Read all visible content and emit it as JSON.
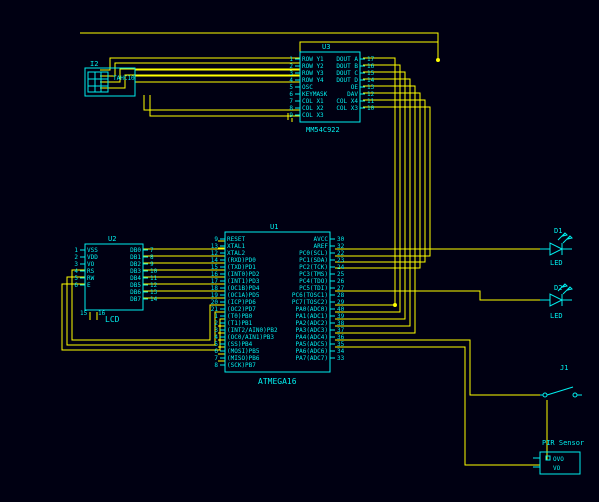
{
  "components": {
    "U1": {
      "ref": "U1",
      "part": "ATMEGA16",
      "left_pins": [
        "RESET",
        "XTAL1",
        "XTAL2",
        "(RXD)PD0",
        "(TXD)PD1",
        "(INT0)PD2",
        "(INT1)PD3",
        "(OC1B)PD4",
        "(OC1A)PD5",
        "(ICP)PD6",
        "(OC2)PD7",
        "(T0)PB0",
        "(T1)PB1",
        "(INT2/AIN0)PB2",
        "(OC0/AIN1)PB3",
        "(SS)PB4",
        "(MOSI)PB5",
        "(MISO)PB6",
        "(SCK)PB7"
      ],
      "right_pins": [
        "AVCC",
        "AREF",
        "PC0(SCL)",
        "PC1(SDA)",
        "PC2(TCK)",
        "PC3(TMS)",
        "PC4(TDO)",
        "PC5(TDI)",
        "PC6(TOSC1)",
        "PC7(TOSC2)",
        "PA0(ADC0)",
        "PA1(ADC1)",
        "PA2(ADC2)",
        "PA3(ADC3)",
        "PA4(ADC4)",
        "PA5(ADC5)",
        "PA6(ADC6)",
        "PA7(ADC7)"
      ],
      "left_nums": [
        "9",
        "13",
        "12",
        "14",
        "15",
        "16",
        "17",
        "18",
        "19",
        "20",
        "21",
        "1",
        "2",
        "3",
        "4",
        "5",
        "6",
        "7",
        "8"
      ],
      "right_nums": [
        "30",
        "32",
        "22",
        "23",
        "24",
        "25",
        "26",
        "27",
        "28",
        "29",
        "40",
        "39",
        "38",
        "37",
        "36",
        "35",
        "34",
        "33"
      ]
    },
    "U2": {
      "ref": "U2",
      "part": "LCD",
      "left_pins": [
        "VSS",
        "VDD",
        "VO",
        "RS",
        "RW",
        "E"
      ],
      "right_pins": [
        "DB0",
        "DB1",
        "DB2",
        "DB3",
        "DB4",
        "DB5",
        "DB6",
        "DB7"
      ],
      "bottom": [
        "15",
        "16"
      ]
    },
    "U3": {
      "ref": "U3",
      "part": "MM54C922",
      "left_pins": [
        "ROW Y1",
        "ROW Y2",
        "ROW Y3",
        "ROW Y4",
        "OSC",
        "KEYMASK",
        "COL X1",
        "COL X2",
        "COL X3"
      ],
      "right_pins": [
        "DOUT A",
        "DOUT B",
        "DOUT C",
        "DOUT D",
        "OE",
        "DAV",
        "COL X4",
        "COL X3"
      ]
    },
    "I2": {
      "ref": "I2",
      "part": "TAHC10"
    },
    "D1": {
      "ref": "D1",
      "part": "LED"
    },
    "D2": {
      "ref": "D2",
      "part": "LED"
    },
    "J1": {
      "ref": "J1"
    },
    "PIR": {
      "title": "PIR Sensor",
      "pins": [
        "OVO",
        "VO"
      ]
    }
  }
}
